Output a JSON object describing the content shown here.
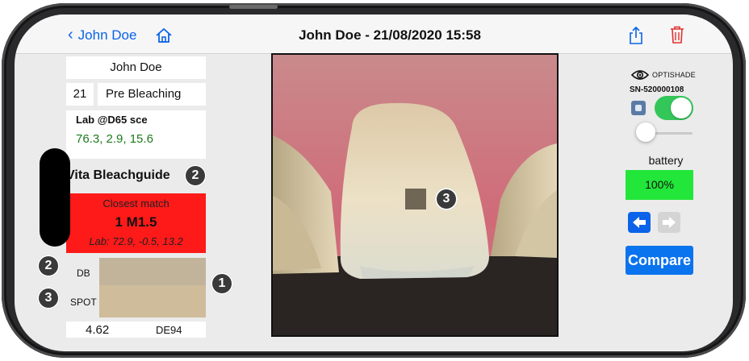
{
  "nav": {
    "back_label": "John Doe",
    "title": "John Doe  - 21/08/2020 15:58"
  },
  "patient": {
    "name": "John Doe",
    "age": "21",
    "stage": "Pre Bleaching"
  },
  "lab": {
    "title": "Lab @D65 sce",
    "values": "76.3, 2.9, 15.6"
  },
  "guide": {
    "title": "Vita Bleachguide",
    "badge": "2"
  },
  "match": {
    "heading": "Closest match",
    "shade": "1 M1.5",
    "lab": "Lab: 72.9, -0.5, 13.2"
  },
  "comparison": {
    "db_label": "DB",
    "spot_label": "SPOT",
    "db_badge": "2",
    "spot_badge": "3",
    "swatch_badge": "1",
    "delta_value": "4.62",
    "delta_unit": "DE94",
    "db_color": "#c1b49a",
    "spot_color": "#cfbc9b"
  },
  "photo": {
    "spot_badge": "3"
  },
  "device": {
    "brand": "OPTISHADE",
    "serial": "SN-520000108",
    "toggle_on": true,
    "slider_level": 0.25,
    "battery_label": "battery",
    "battery_value": "100%",
    "compare_label": "Compare"
  },
  "colors": {
    "accent": "#0a63e8",
    "match_bg": "#ff1a1a",
    "battery_bg": "#22e63a",
    "lab_values": "#1d7a1d",
    "delete": "#e0322e"
  }
}
